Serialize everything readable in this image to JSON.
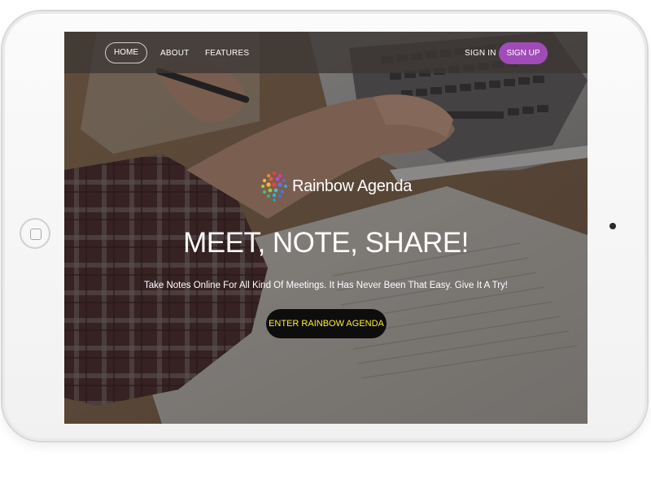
{
  "nav": {
    "home_label": "HOME",
    "about_label": "ABOUT",
    "features_label": "FEATURES",
    "signin_label": "SIGN IN",
    "signup_label": "SIGN UP"
  },
  "hero": {
    "brand_name": "Rainbow Agenda",
    "headline": "MEET, NOTE, SHARE!",
    "tagline": "Take Notes Online For All Kind Of Meetings. It Has Never Been That Easy. Give It A Try!",
    "cta_label": "ENTER RAINBOW AGENDA"
  },
  "icons": {
    "logo": "rainbow-dots-logo",
    "device_home": "tablet-home-button",
    "device_camera": "tablet-camera"
  },
  "colors": {
    "signup_bg": "#a14bb8",
    "cta_bg": "#0d0d0d",
    "cta_text": "#ffee33",
    "nav_bg": "rgba(60,55,52,0.78)"
  }
}
